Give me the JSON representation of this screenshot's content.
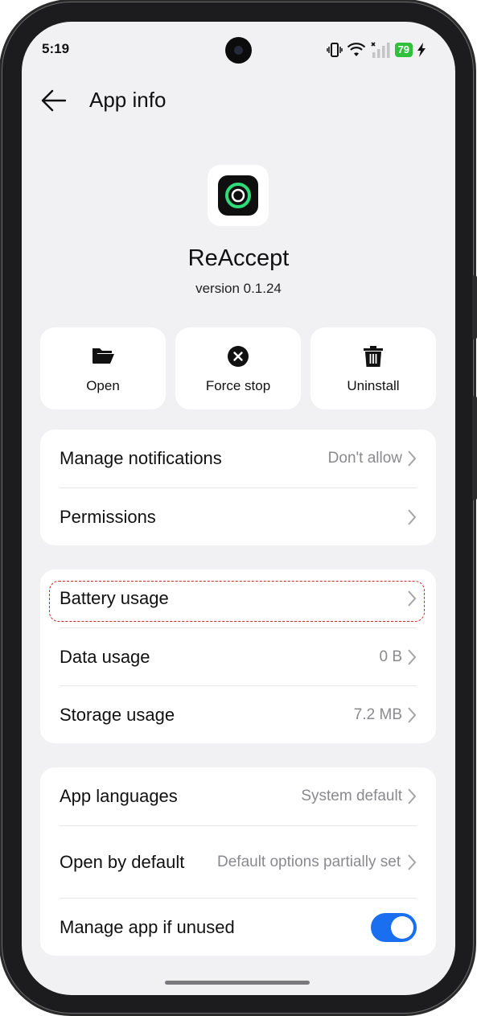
{
  "status_bar": {
    "time": "5:19",
    "battery": "79"
  },
  "header": {
    "title": "App info"
  },
  "app": {
    "name": "ReAccept",
    "version": "version 0.1.24"
  },
  "actions": [
    {
      "label": "Open",
      "icon": "folder-open-icon"
    },
    {
      "label": "Force stop",
      "icon": "close-circle-icon"
    },
    {
      "label": "Uninstall",
      "icon": "trash-icon"
    }
  ],
  "card1": {
    "manage_notifications": {
      "label": "Manage notifications",
      "value": "Don't allow"
    },
    "permissions": {
      "label": "Permissions"
    }
  },
  "card2": {
    "battery_usage": {
      "label": "Battery usage"
    },
    "data_usage": {
      "label": "Data usage",
      "value": "0 B"
    },
    "storage_usage": {
      "label": "Storage usage",
      "value": "7.2 MB"
    }
  },
  "card3": {
    "app_languages": {
      "label": "App languages",
      "value": "System default"
    },
    "open_by_default": {
      "label": "Open by default",
      "value": "Default options partially set"
    },
    "manage_if_unused": {
      "label": "Manage app if unused",
      "enabled": true
    }
  },
  "colors": {
    "accent": "#1a6ff0",
    "highlight": "#d0262b",
    "battery": "#30c03c",
    "background": "#f1f1f3"
  }
}
